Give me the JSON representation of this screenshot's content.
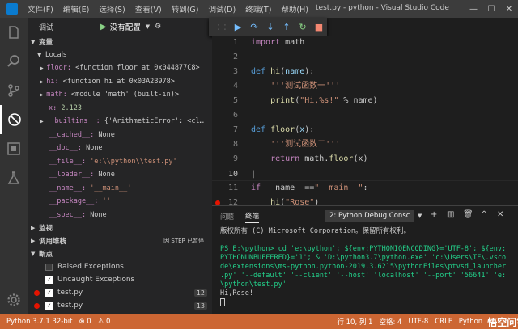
{
  "titlebar": {
    "menu": [
      "文件(F)",
      "编辑(E)",
      "选择(S)",
      "查看(V)",
      "转到(G)",
      "调试(D)",
      "终端(T)",
      "帮助(H)"
    ],
    "title": "test.py - python - Visual Studio Code"
  },
  "debug": {
    "label": "调试",
    "config": "没有配置"
  },
  "variables": {
    "header": "变量",
    "locals_header": "Locals",
    "items": [
      {
        "name": "floor:",
        "value": "<function floor at 0x044877C8>"
      },
      {
        "name": "hi:",
        "value": "<function hi at 0x03A2B978>"
      },
      {
        "name": "math:",
        "value": "<module 'math' (built-in)>"
      },
      {
        "name": "x:",
        "value": "2.123"
      },
      {
        "name": "__builtins__:",
        "value": "{'ArithmeticError': <cl…"
      },
      {
        "name": "__cached__:",
        "value": "None"
      },
      {
        "name": "__doc__:",
        "value": "None"
      },
      {
        "name": "__file__:",
        "value": "'e:\\\\python\\\\test.py'"
      },
      {
        "name": "__loader__:",
        "value": "None"
      },
      {
        "name": "__name__:",
        "value": "'__main__'"
      },
      {
        "name": "__package__:",
        "value": "''"
      },
      {
        "name": "__spec__:",
        "value": "None"
      }
    ]
  },
  "watch_header": "监视",
  "callstack": {
    "header": "调用堆栈",
    "state": "因 STEP 已暂停"
  },
  "breakpoints": {
    "header": "断点",
    "items": [
      {
        "label": "Raised Exceptions",
        "checked": false,
        "line": ""
      },
      {
        "label": "Uncaught Exceptions",
        "checked": true,
        "line": ""
      },
      {
        "label": "test.py",
        "checked": true,
        "line": "12"
      },
      {
        "label": "test.py",
        "checked": true,
        "line": "13"
      },
      {
        "label": "test.py",
        "checked": true,
        "line": "14"
      }
    ]
  },
  "panel": {
    "tabs": [
      "问题",
      "终端"
    ],
    "terminal_select": "2: Python Debug Consc",
    "lines": [
      "版权所有 (C) Microsoft Corporation。保留所有权利。",
      "",
      "PS E:\\python> cd 'e:\\python'; ${env:PYTHONIOENCODING}='UTF-8'; ${env:",
      "PYTHONUNBUFFERED}='1'; & 'D:\\python3.7\\python.exe' 'c:\\Users\\TF\\.vsco",
      "de\\extensions\\ms-python.python-2019.3.6215\\pythonFiles\\ptvsd_launcher",
      ".py' '--default' '--client' '--host' 'localhost' '--port' '56641' 'e:",
      "\\python\\test.py'",
      "Hi,Rose!"
    ]
  },
  "status": {
    "python": "Python 3.7.1 32-bit",
    "errors": "⊗ 0",
    "warnings": "⚠ 0",
    "position": "行 10, 列 1",
    "spaces": "空格: 4",
    "encoding": "UTF-8",
    "eol": "CRLF",
    "language": "Python",
    "watermark": "悟空问答"
  },
  "colors": {
    "statusbar": "#cc6633",
    "breakpoint": "#e51400"
  }
}
